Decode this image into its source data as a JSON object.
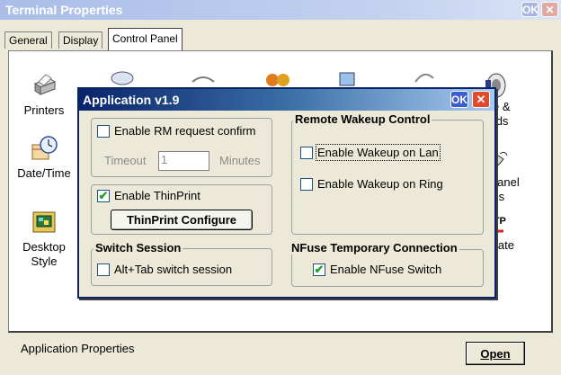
{
  "window": {
    "title": "Terminal Properties",
    "ok_label": "OK",
    "close_glyph": "✕"
  },
  "tabs": [
    {
      "label": "General"
    },
    {
      "label": "Display"
    },
    {
      "label": "Control Panel"
    }
  ],
  "control_panel": {
    "items": [
      {
        "label": "Printers",
        "icon": "printer-icon"
      },
      {
        "label": "Date/Time",
        "icon": "clock-icon"
      },
      {
        "label": "Desktop Style",
        "icon": "desktop-style-icon"
      },
      {
        "label": "ume &",
        "label2": "ounds",
        "icon": "speaker-icon"
      },
      {
        "label": "th Panel",
        "label2": "ttings",
        "icon": "stylus-icon"
      },
      {
        "label": "Update",
        "icon": "ftp-icon"
      }
    ]
  },
  "status_bar": {
    "text": "Application Properties",
    "open_label": "Open"
  },
  "dialog": {
    "title": "Application v1.9",
    "ok_label": "OK",
    "close_glyph": "✕",
    "rm_group": {
      "enable_rm_label": "Enable RM request confirm",
      "enable_rm_checked": false,
      "timeout_label": "Timeout",
      "timeout_value": "1",
      "minutes_label": "Minutes"
    },
    "thinprint_group": {
      "enable_thinprint_label": "Enable ThinPrint",
      "enable_thinprint_checked": true,
      "configure_label": "ThinPrint Configure"
    },
    "switch_session": {
      "title": "Switch Session",
      "alt_tab_label": "Alt+Tab switch session",
      "alt_tab_checked": false
    },
    "remote_wakeup": {
      "title": "Remote Wakeup Control",
      "wake_lan_label": "Enable Wakeup on Lan",
      "wake_lan_checked": false,
      "wake_ring_label": "Enable Wakeup on Ring",
      "wake_ring_checked": false
    },
    "nfuse": {
      "title": "NFuse Temporary Connection",
      "switch_label": "Enable NFuse Switch",
      "switch_checked": true
    }
  }
}
